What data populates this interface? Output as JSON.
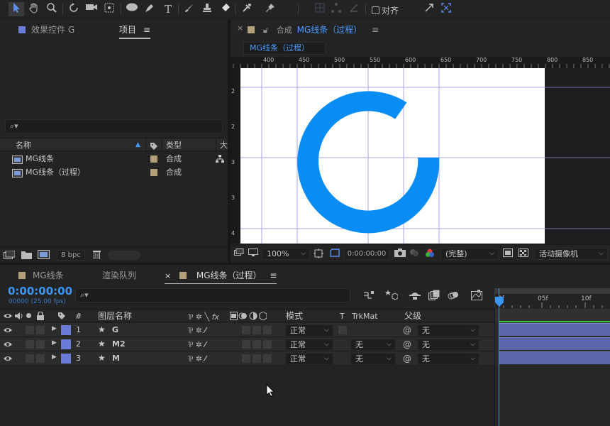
{
  "toolbar": {
    "tools": [
      "selection-tool",
      "hand-tool",
      "zoom-tool",
      "rotate-tool",
      "camera-tool",
      "pan-behind-tool",
      "ellipse-tool",
      "pen-tool",
      "text-tool",
      "brush-tool",
      "clone-stamp-tool",
      "eraser-tool",
      "roto-brush-tool",
      "puppet-pin-tool"
    ],
    "align_label": "对齐"
  },
  "project_panel": {
    "tab_effects": "效果控件 G",
    "tab_project": "项目",
    "search_placeholder": "",
    "columns": {
      "name": "名称",
      "type": "类型",
      "size": "大"
    },
    "items": [
      {
        "name": "MG线条",
        "type": "合成"
      },
      {
        "name": "MG线条（过程）",
        "type": "合成"
      }
    ],
    "bpc": "8 bpc"
  },
  "comp_panel": {
    "tab_prefix": "合成",
    "tab_name": "MG线条（过程）",
    "breadcrumb": "MG线条（过程）",
    "ruler_h": [
      "400",
      "450",
      "500",
      "550",
      "600",
      "650",
      "700",
      "750",
      "800",
      "850"
    ],
    "ruler_v": [
      "2",
      "2",
      "3",
      "3",
      "4"
    ],
    "zoom": "100%",
    "timecode": "0:00:00:00",
    "resolution": "(完整)",
    "camera": "活动摄像机",
    "shape_color": "#0a8cf5"
  },
  "bottom_tabs": {
    "tab1": "MG线条",
    "tab2": "渲染队列",
    "tab3": "MG线条（过程）"
  },
  "timeline": {
    "timecode": "0:00:00:00",
    "frames": "00000 (25.00 fps)",
    "columns": {
      "num": "#",
      "layer_name": "图层名称",
      "mode": "模式",
      "t": "T",
      "trkmat": "TrkMat",
      "parent": "父级"
    },
    "layers": [
      {
        "num": "1",
        "name": "G",
        "mode": "正常",
        "trkmat": "",
        "parent": "无"
      },
      {
        "num": "2",
        "name": "M2",
        "mode": "正常",
        "trkmat": "无",
        "parent": "无"
      },
      {
        "num": "3",
        "name": "M",
        "mode": "正常",
        "trkmat": "无",
        "parent": "无"
      }
    ],
    "ruler": [
      "0f",
      "05f",
      "10f"
    ],
    "layer_color": "#6a7bd8"
  }
}
